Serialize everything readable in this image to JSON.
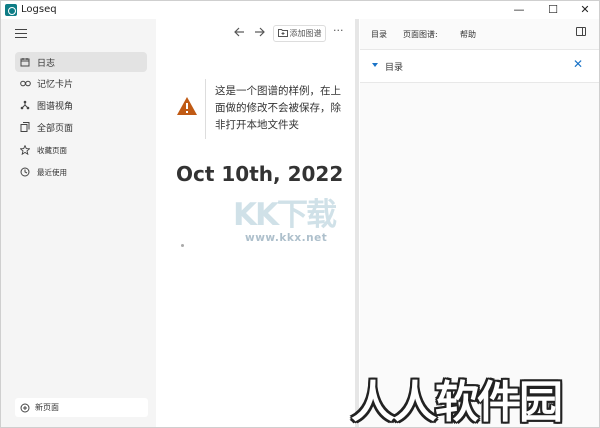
{
  "titlebar": {
    "title": "Logseq",
    "min_glyph": "—",
    "max_glyph": "☐",
    "close_glyph": "✕"
  },
  "sidebar": {
    "items": [
      {
        "label": "日志",
        "icon": "calendar-icon"
      },
      {
        "label": "记忆卡片",
        "icon": "infinity-icon"
      },
      {
        "label": "图谱视角",
        "icon": "graph-icon"
      },
      {
        "label": "全部页面",
        "icon": "pages-icon"
      },
      {
        "label": "收藏页面",
        "icon": "star-icon"
      },
      {
        "label": "最近使用",
        "icon": "history-icon"
      }
    ],
    "new_page_label": "新页面"
  },
  "main": {
    "add_graph_label": "添加图谱",
    "more_glyph": "···",
    "notice_text": "这是一个图谱的样例，在上面做的修改不会被保存，除非打开本地文件夹",
    "journal_title": "Oct 10th, 2022"
  },
  "right_panel": {
    "tabs": [
      "目录",
      "页面图谱:",
      "帮助"
    ],
    "toc_label": "目录"
  },
  "watermarks": {
    "kk": "KK下载",
    "url": "www.kkx.net",
    "rr": "人人软件园"
  },
  "colors": {
    "accent": "#1a73c7",
    "warning": "#c05a14",
    "sidebar_bg": "#f5f5f5"
  }
}
